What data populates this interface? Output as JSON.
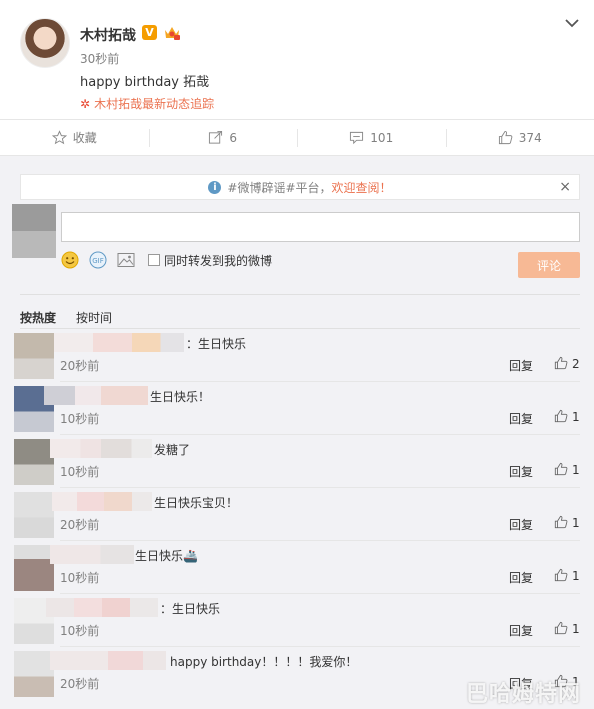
{
  "post": {
    "author": "木村拓哉",
    "verified_badge": "V",
    "time": "30秒前",
    "text": "happy birthday  拓哉",
    "follow_link": "木村拓哉最新动态追踪"
  },
  "actions": {
    "favorite_label": "收藏",
    "forward_count": "6",
    "comment_count": "101",
    "like_count": "374"
  },
  "composer": {
    "notice_prefix": "#微博辟谣#平台，",
    "notice_highlight": "欢迎查阅！",
    "notice_close": "×",
    "forward_label": "同时转发到我的微博",
    "submit_label": "评论"
  },
  "sort": {
    "hot": "按热度",
    "time": "按时间"
  },
  "reply_label": "回复",
  "comments": [
    {
      "text": "：生日快乐",
      "time": "20秒前",
      "likes": "2"
    },
    {
      "text": "生日快乐！",
      "time": "10秒前",
      "likes": "1"
    },
    {
      "text": "发糖了",
      "time": "10秒前",
      "likes": "1"
    },
    {
      "text": "生日快乐宝贝！",
      "time": "20秒前",
      "likes": "1"
    },
    {
      "text": "生日快乐🚢",
      "time": "10秒前",
      "likes": "1"
    },
    {
      "text": "：生日快乐",
      "time": "10秒前",
      "likes": "1"
    },
    {
      "text": "happy birthday！！！！我爱你！",
      "time": "20秒前",
      "likes": "1"
    }
  ],
  "watermark": "巴哈姆特网",
  "colors": {
    "accent": "#eb7350",
    "submit_bg": "#f7b995",
    "verified": "#f59d00"
  }
}
